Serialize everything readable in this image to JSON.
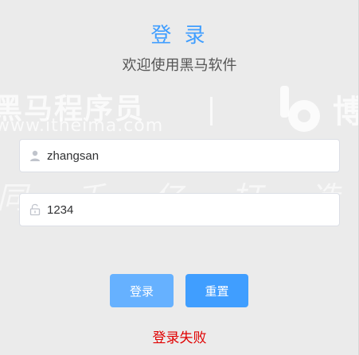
{
  "form": {
    "title": "登 录",
    "subtitle": "欢迎使用黑马软件",
    "username": {
      "value": "zhangsan",
      "icon": "user-icon"
    },
    "password": {
      "value": "1234",
      "icon": "lock-icon"
    },
    "login_button": "登录",
    "reset_button": "重置",
    "error_message": "登录失败"
  },
  "watermark": {
    "brand": "黑马程序员",
    "url": "www.itheima.com",
    "logo_text": "博",
    "slogan": "同 千 亿   打 造 最 高 效"
  },
  "colors": {
    "primary": "#409eff",
    "primary_light": "#66b1ff",
    "error": "#e00000",
    "background": "#ebebeb"
  }
}
